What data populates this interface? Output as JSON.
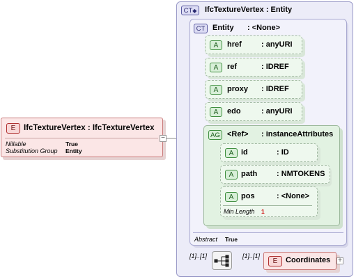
{
  "root_element": {
    "badge": "E",
    "name": "IfcTextureVertex : IfcTextureVertex",
    "props": [
      {
        "label": "Nillable",
        "value": "True"
      },
      {
        "label": "Substitution Group",
        "value": "Entity"
      }
    ],
    "expand_symbol": "−"
  },
  "complex_type": {
    "badge": "CT",
    "name": "IfcTextureVertex : Entity",
    "base": {
      "badge": "CT",
      "name": "Entity",
      "type": ": <None>",
      "attributes": [
        {
          "badge": "A",
          "name": "href",
          "type": ": anyURI"
        },
        {
          "badge": "A",
          "name": "ref",
          "type": ": IDREF"
        },
        {
          "badge": "A",
          "name": "proxy",
          "type": ": IDREF"
        },
        {
          "badge": "A",
          "name": "edo",
          "type": ": anyURI"
        }
      ],
      "attribute_group": {
        "badge": "AG",
        "name": "<Ref>",
        "type": ": instanceAttributes",
        "attributes": [
          {
            "badge": "A",
            "name": "id",
            "type": ": ID"
          },
          {
            "badge": "A",
            "name": "path",
            "type": ": NMTOKENS"
          },
          {
            "badge": "A",
            "name": "pos",
            "type": ": <None>",
            "facet_label": "Min Length",
            "facet_value": "1"
          }
        ]
      },
      "abstract_label": "Abstract",
      "abstract_value": "True"
    },
    "sequence": {
      "multiplicity": "[1]..[1]",
      "child_multiplicity": "[1]..[1]",
      "child": {
        "badge": "E",
        "name": "Coordinates",
        "expand_symbol": "+"
      }
    }
  },
  "colors": {
    "ct_fill": "#ececf8",
    "ct_border": "#9a9ac8",
    "element_fill": "#fbe6e6",
    "element_border": "#c87878",
    "attr_fill": "#eef8ee",
    "ag_fill": "#e2f2e2",
    "accent_red": "#cc0000"
  }
}
